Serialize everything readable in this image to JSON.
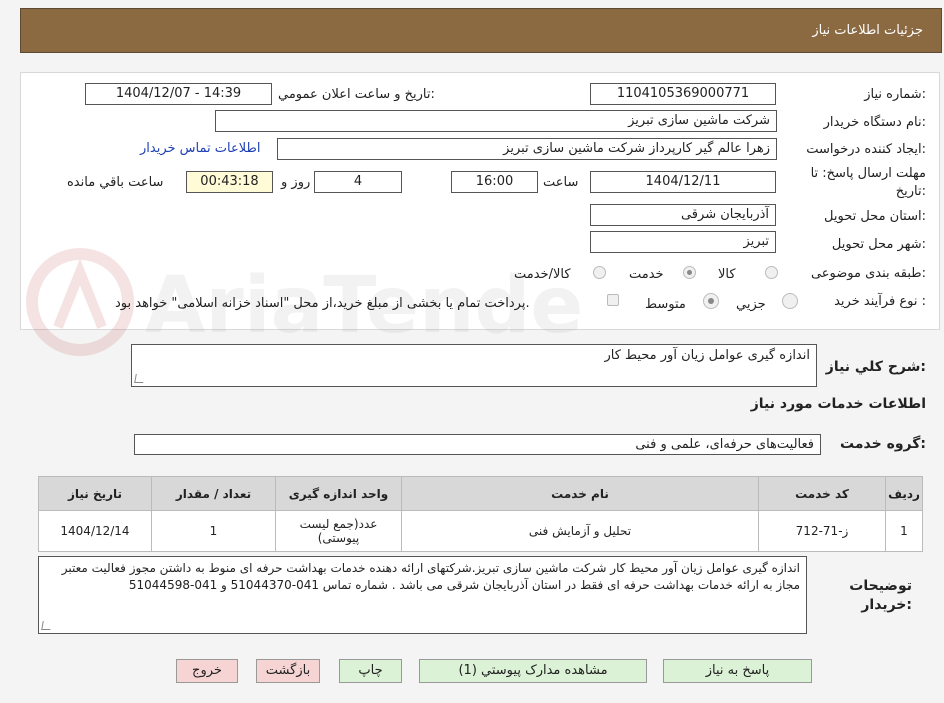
{
  "page": {
    "title": "جزئيات اطلاعات نياز"
  },
  "labels": {
    "need_number": "شماره نياز:",
    "announce_datetime": "تاريخ و ساعت اعلان عمومي:",
    "buyer_org": "نام دستگاه خريدار:",
    "requester": "ايجاد کننده درخواست:",
    "deadline_line1": "مهلت ارسال پاسخ: تا",
    "deadline_line2": "تاريخ:",
    "time_word": "ساعت",
    "day_and": "روز و",
    "remaining": "ساعت باقي مانده",
    "province": "استان محل تحويل:",
    "city": "شهر محل تحويل:",
    "category": "طبقه بندی موضوعی:",
    "process_type": "نوع فرآيند خريد :",
    "general_desc": "شرح کلي نياز:",
    "services_info": "اطلاعات خدمات مورد نياز",
    "service_group": "گروه خدمت:",
    "buyer_notes_line1": "توضيحات",
    "buyer_notes_line2": "خريدار:"
  },
  "values": {
    "need_number": "1104105369000771",
    "announce_datetime": "1404/12/07 - 14:39",
    "buyer_org": "شرکت ماشين سازی تبريز",
    "requester": "زهرا عالم گير کارپرداز شرکت ماشين سازی تبريز",
    "contact_link": "اطلاعات تماس خريدار",
    "deadline_date": "1404/12/11",
    "deadline_time": "16:00",
    "days": "4",
    "remaining_time": "00:43:18",
    "province": "آذربايجان شرقی",
    "city": "تبريز",
    "general_desc": "اندازه گيری عوامل زيان آور محيط کار",
    "service_group": "فعاليت‌های حرفه‌ای، علمی و فنی",
    "buyer_notes": "اندازه گيری عوامل زيان آور محيط کار شرکت ماشين سازی تبريز.شرکتهای ارائه دهنده خدمات بهداشت حرفه ای منوط به داشتن مجوز فعاليت معتبر مجاز به ارائه خدمات بهداشت حرفه ای فقط در استان آذربايجان شرقی می باشد . شماره تماس 041-51044370 و 041-51044598"
  },
  "category_options": {
    "goods": "کالا",
    "service": "خدمت",
    "goods_service": "کالا/خدمت",
    "selected": "service"
  },
  "process_options": {
    "partial": "جزيي",
    "medium": "متوسط",
    "selected": "medium",
    "treasury_note": "پرداخت تمام يا بخشی از مبلغ خريد،از محل \"اسناد خزانه اسلامی\" خواهد بود."
  },
  "table": {
    "headers": {
      "row": "رديف",
      "code": "کد خدمت",
      "name": "نام خدمت",
      "unit": "واحد اندازه گيری",
      "count": "تعداد / مقدار",
      "date": "تاريخ نياز"
    },
    "rows": [
      {
        "row": "1",
        "code": "ز-71-712",
        "name": "تحليل و آزمايش فنی",
        "unit": "عدد(جمع ليست پيوستی)",
        "count": "1",
        "date": "1404/12/14"
      }
    ]
  },
  "buttons": {
    "reply": "پاسخ به نياز",
    "attachments": "مشاهده مدارک پيوستي (1)",
    "print": "چاپ",
    "back": "بازگشت",
    "exit": "خروج"
  },
  "watermark": {
    "text": "AriaTender.neT"
  },
  "colors": {
    "header_bg": "#8b6a42",
    "link": "#1f3fb5",
    "green_button": "#dcf2d6",
    "pink_button": "#f6d4d4",
    "highlight": "#fffbd6"
  }
}
